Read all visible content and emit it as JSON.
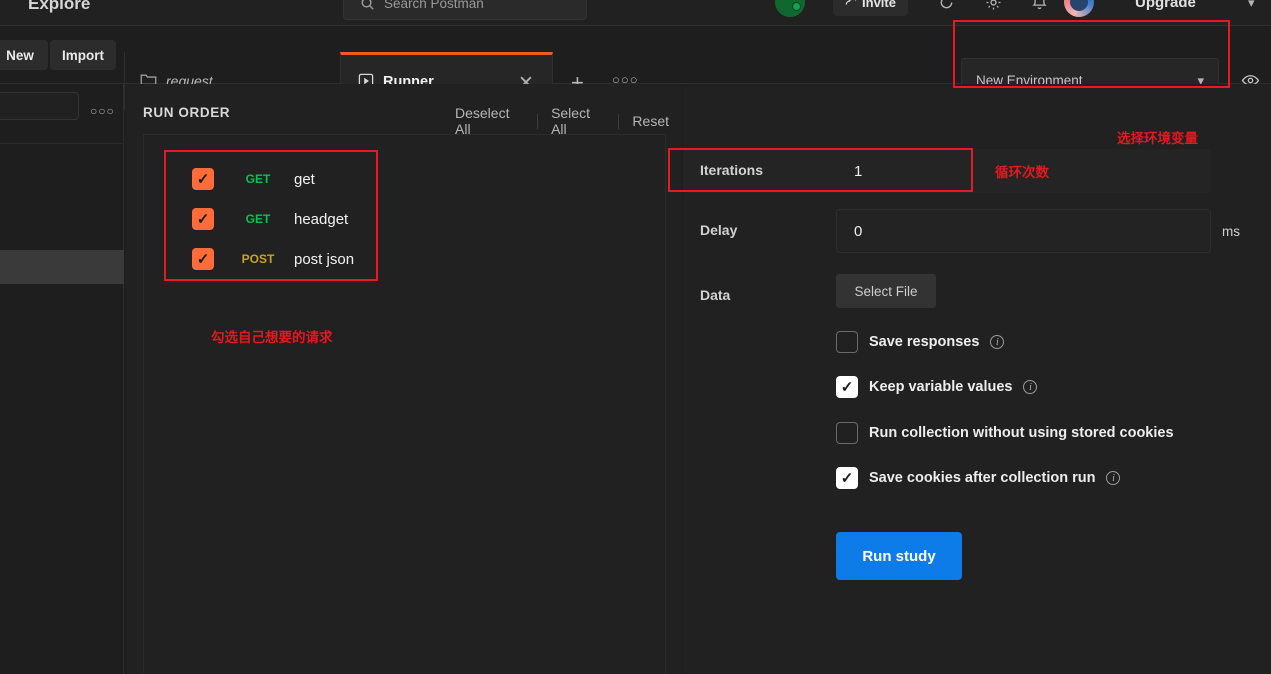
{
  "header": {
    "explore": "Explore",
    "search_placeholder": "Search Postman",
    "search_icon": "search-icon",
    "invite_label": "Invite",
    "invite_icon": "person-plus-icon",
    "sync_icon": "sync-icon",
    "settings_icon": "gear-icon",
    "notifications_icon": "bell-icon",
    "avatar": "user-avatar",
    "upgrade_label": "Upgrade",
    "chevron_icon": "chevron-down-icon",
    "status_icon": "connected-status-icon"
  },
  "tabbar": {
    "new_label": "New",
    "import_label": "Import",
    "tabs": [
      {
        "label": "request",
        "icon": "folder-icon",
        "active": false
      },
      {
        "label": "Runner",
        "icon": "play-square-icon",
        "active": true
      }
    ],
    "close_icon": "close-icon",
    "add_icon": "plus-icon",
    "more_icon": "more-horizontal-icon",
    "environment": {
      "value": "New Environment",
      "chevron_icon": "chevron-down-icon",
      "eye_icon": "eye-icon"
    }
  },
  "sidebar": {
    "more_icon": "more-horizontal-icon"
  },
  "run_order": {
    "title": "RUN ORDER",
    "actions": [
      "Deselect All",
      "Select All",
      "Reset"
    ],
    "requests": [
      {
        "method": "GET",
        "name": "get",
        "checked": true
      },
      {
        "method": "GET",
        "name": "headget",
        "checked": true
      },
      {
        "method": "POST",
        "name": "post json",
        "checked": true
      }
    ]
  },
  "config": {
    "iterations_label": "Iterations",
    "iterations_value": "1",
    "delay_label": "Delay",
    "delay_value": "0",
    "delay_unit": "ms",
    "data_label": "Data",
    "select_file_label": "Select File",
    "options": [
      {
        "label": "Save responses",
        "checked": false,
        "info": true
      },
      {
        "label": "Keep variable values",
        "checked": true,
        "info": true
      },
      {
        "label": "Run collection without using stored cookies",
        "checked": false,
        "info": false
      },
      {
        "label": "Save cookies after collection run",
        "checked": true,
        "info": true
      }
    ],
    "run_button_label": "Run study"
  },
  "annotations": {
    "env": "选择环境变量",
    "iterations": "循环次数",
    "requests": "勾选自己想要的请求"
  },
  "colors": {
    "accent_orange": "#ff6c37",
    "method_get": "#0cbf52",
    "method_post": "#c9a227",
    "run_button": "#0d7ce8",
    "annotation_red": "#e51a25"
  }
}
